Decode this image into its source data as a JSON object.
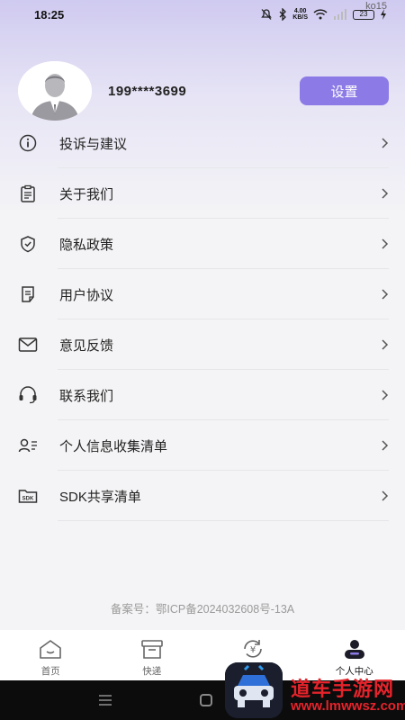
{
  "status_bar": {
    "time": "18:25",
    "speed_value": "4.00",
    "speed_unit": "KB/S",
    "battery": "23"
  },
  "watermark_top": "ko15",
  "profile": {
    "phone": "199****3699",
    "settings_label": "设置"
  },
  "menu": {
    "items": [
      {
        "label": "投诉与建议",
        "icon": "info-icon"
      },
      {
        "label": "关于我们",
        "icon": "clipboard-icon"
      },
      {
        "label": "隐私政策",
        "icon": "shield-icon"
      },
      {
        "label": "用户协议",
        "icon": "document-icon"
      },
      {
        "label": "意见反馈",
        "icon": "mail-icon"
      },
      {
        "label": "联系我们",
        "icon": "headset-icon"
      },
      {
        "label": "个人信息收集清单",
        "icon": "person-list-icon"
      },
      {
        "label": "SDK共享清单",
        "icon": "sdk-folder-icon"
      }
    ]
  },
  "icp": "备案号：鄂ICP备2024032608号-13A",
  "tabbar": {
    "tabs": [
      {
        "label": "首页",
        "icon": "home-icon"
      },
      {
        "label": "快递",
        "icon": "box-icon"
      },
      {
        "label": "",
        "icon": "yuan-cycle-icon"
      },
      {
        "label": "个人中心",
        "icon": "profile-icon"
      }
    ],
    "active_index": 3
  },
  "watermark": {
    "site_name": "道车手游网",
    "site_url": "www.lmwwsz.com"
  },
  "colors": {
    "accent": "#8c7ae6",
    "watermark": "#e5232b"
  }
}
